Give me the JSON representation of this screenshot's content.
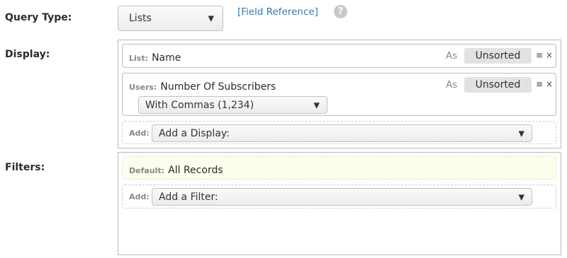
{
  "query_type": {
    "label": "Query Type:",
    "value": "Lists",
    "field_reference_link": "[Field Reference]",
    "help_icon": "?"
  },
  "display": {
    "label": "Display:",
    "items": [
      {
        "tag": "List:",
        "field": "Name",
        "as_label": "As",
        "sort": "Unsorted"
      },
      {
        "tag": "Users:",
        "field": "Number Of Subscribers",
        "as_label": "As",
        "sort": "Unsorted",
        "format": "With Commas (1,234)"
      }
    ],
    "add": {
      "tag": "Add:",
      "placeholder": "Add a Display:"
    }
  },
  "filters": {
    "label": "Filters:",
    "default": {
      "tag": "Default:",
      "value": "All Records"
    },
    "add": {
      "tag": "Add:",
      "placeholder": "Add a Filter:"
    }
  },
  "icons": {
    "caret": "▼",
    "reorder": "≡",
    "remove": "×"
  },
  "colors": {
    "link": "#2f7bb6",
    "default_bg": "#fdfdee"
  }
}
